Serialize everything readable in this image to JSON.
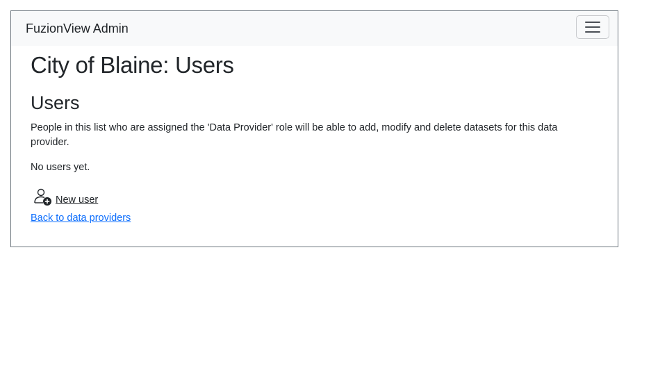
{
  "navbar": {
    "brand": "FuzionView Admin",
    "toggler_icon": "hamburger-menu-icon"
  },
  "page": {
    "title": "City of Blaine: Users"
  },
  "users_section": {
    "heading": "Users",
    "description": "People in this list who are assigned the 'Data Provider' role will be able to add, modify and delete datasets for this data provider.",
    "empty_message": "No users yet."
  },
  "actions": {
    "new_user_icon": "person-add-icon",
    "new_user_label": "New user",
    "back_label": "Back to data providers"
  },
  "colors": {
    "link": "#0d6efd",
    "navbar_bg": "#f8f9fa",
    "text": "#212529"
  }
}
